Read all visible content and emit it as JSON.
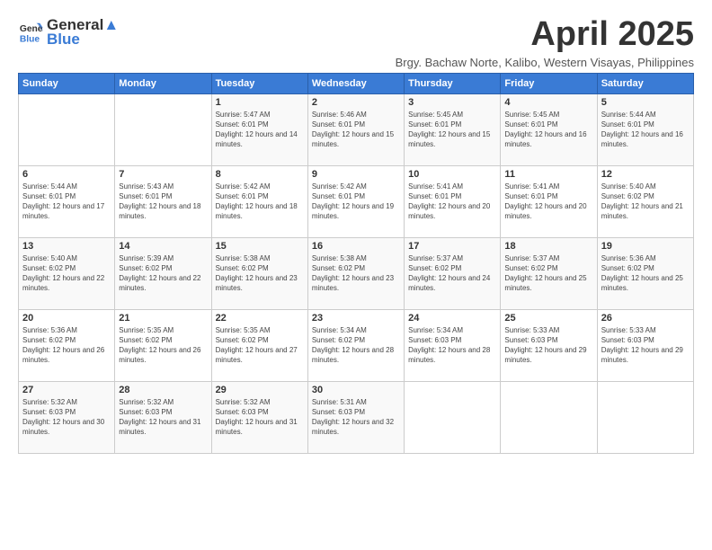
{
  "logo": {
    "text_general": "General",
    "text_blue": "Blue"
  },
  "header": {
    "month_year": "April 2025",
    "subtitle": "Brgy. Bachaw Norte, Kalibo, Western Visayas, Philippines"
  },
  "days_of_week": [
    "Sunday",
    "Monday",
    "Tuesday",
    "Wednesday",
    "Thursday",
    "Friday",
    "Saturday"
  ],
  "weeks": [
    [
      {
        "day": "",
        "sunrise": "",
        "sunset": "",
        "daylight": ""
      },
      {
        "day": "",
        "sunrise": "",
        "sunset": "",
        "daylight": ""
      },
      {
        "day": "1",
        "sunrise": "Sunrise: 5:47 AM",
        "sunset": "Sunset: 6:01 PM",
        "daylight": "Daylight: 12 hours and 14 minutes."
      },
      {
        "day": "2",
        "sunrise": "Sunrise: 5:46 AM",
        "sunset": "Sunset: 6:01 PM",
        "daylight": "Daylight: 12 hours and 15 minutes."
      },
      {
        "day": "3",
        "sunrise": "Sunrise: 5:45 AM",
        "sunset": "Sunset: 6:01 PM",
        "daylight": "Daylight: 12 hours and 15 minutes."
      },
      {
        "day": "4",
        "sunrise": "Sunrise: 5:45 AM",
        "sunset": "Sunset: 6:01 PM",
        "daylight": "Daylight: 12 hours and 16 minutes."
      },
      {
        "day": "5",
        "sunrise": "Sunrise: 5:44 AM",
        "sunset": "Sunset: 6:01 PM",
        "daylight": "Daylight: 12 hours and 16 minutes."
      }
    ],
    [
      {
        "day": "6",
        "sunrise": "Sunrise: 5:44 AM",
        "sunset": "Sunset: 6:01 PM",
        "daylight": "Daylight: 12 hours and 17 minutes."
      },
      {
        "day": "7",
        "sunrise": "Sunrise: 5:43 AM",
        "sunset": "Sunset: 6:01 PM",
        "daylight": "Daylight: 12 hours and 18 minutes."
      },
      {
        "day": "8",
        "sunrise": "Sunrise: 5:42 AM",
        "sunset": "Sunset: 6:01 PM",
        "daylight": "Daylight: 12 hours and 18 minutes."
      },
      {
        "day": "9",
        "sunrise": "Sunrise: 5:42 AM",
        "sunset": "Sunset: 6:01 PM",
        "daylight": "Daylight: 12 hours and 19 minutes."
      },
      {
        "day": "10",
        "sunrise": "Sunrise: 5:41 AM",
        "sunset": "Sunset: 6:01 PM",
        "daylight": "Daylight: 12 hours and 20 minutes."
      },
      {
        "day": "11",
        "sunrise": "Sunrise: 5:41 AM",
        "sunset": "Sunset: 6:01 PM",
        "daylight": "Daylight: 12 hours and 20 minutes."
      },
      {
        "day": "12",
        "sunrise": "Sunrise: 5:40 AM",
        "sunset": "Sunset: 6:02 PM",
        "daylight": "Daylight: 12 hours and 21 minutes."
      }
    ],
    [
      {
        "day": "13",
        "sunrise": "Sunrise: 5:40 AM",
        "sunset": "Sunset: 6:02 PM",
        "daylight": "Daylight: 12 hours and 22 minutes."
      },
      {
        "day": "14",
        "sunrise": "Sunrise: 5:39 AM",
        "sunset": "Sunset: 6:02 PM",
        "daylight": "Daylight: 12 hours and 22 minutes."
      },
      {
        "day": "15",
        "sunrise": "Sunrise: 5:38 AM",
        "sunset": "Sunset: 6:02 PM",
        "daylight": "Daylight: 12 hours and 23 minutes."
      },
      {
        "day": "16",
        "sunrise": "Sunrise: 5:38 AM",
        "sunset": "Sunset: 6:02 PM",
        "daylight": "Daylight: 12 hours and 23 minutes."
      },
      {
        "day": "17",
        "sunrise": "Sunrise: 5:37 AM",
        "sunset": "Sunset: 6:02 PM",
        "daylight": "Daylight: 12 hours and 24 minutes."
      },
      {
        "day": "18",
        "sunrise": "Sunrise: 5:37 AM",
        "sunset": "Sunset: 6:02 PM",
        "daylight": "Daylight: 12 hours and 25 minutes."
      },
      {
        "day": "19",
        "sunrise": "Sunrise: 5:36 AM",
        "sunset": "Sunset: 6:02 PM",
        "daylight": "Daylight: 12 hours and 25 minutes."
      }
    ],
    [
      {
        "day": "20",
        "sunrise": "Sunrise: 5:36 AM",
        "sunset": "Sunset: 6:02 PM",
        "daylight": "Daylight: 12 hours and 26 minutes."
      },
      {
        "day": "21",
        "sunrise": "Sunrise: 5:35 AM",
        "sunset": "Sunset: 6:02 PM",
        "daylight": "Daylight: 12 hours and 26 minutes."
      },
      {
        "day": "22",
        "sunrise": "Sunrise: 5:35 AM",
        "sunset": "Sunset: 6:02 PM",
        "daylight": "Daylight: 12 hours and 27 minutes."
      },
      {
        "day": "23",
        "sunrise": "Sunrise: 5:34 AM",
        "sunset": "Sunset: 6:02 PM",
        "daylight": "Daylight: 12 hours and 28 minutes."
      },
      {
        "day": "24",
        "sunrise": "Sunrise: 5:34 AM",
        "sunset": "Sunset: 6:03 PM",
        "daylight": "Daylight: 12 hours and 28 minutes."
      },
      {
        "day": "25",
        "sunrise": "Sunrise: 5:33 AM",
        "sunset": "Sunset: 6:03 PM",
        "daylight": "Daylight: 12 hours and 29 minutes."
      },
      {
        "day": "26",
        "sunrise": "Sunrise: 5:33 AM",
        "sunset": "Sunset: 6:03 PM",
        "daylight": "Daylight: 12 hours and 29 minutes."
      }
    ],
    [
      {
        "day": "27",
        "sunrise": "Sunrise: 5:32 AM",
        "sunset": "Sunset: 6:03 PM",
        "daylight": "Daylight: 12 hours and 30 minutes."
      },
      {
        "day": "28",
        "sunrise": "Sunrise: 5:32 AM",
        "sunset": "Sunset: 6:03 PM",
        "daylight": "Daylight: 12 hours and 31 minutes."
      },
      {
        "day": "29",
        "sunrise": "Sunrise: 5:32 AM",
        "sunset": "Sunset: 6:03 PM",
        "daylight": "Daylight: 12 hours and 31 minutes."
      },
      {
        "day": "30",
        "sunrise": "Sunrise: 5:31 AM",
        "sunset": "Sunset: 6:03 PM",
        "daylight": "Daylight: 12 hours and 32 minutes."
      },
      {
        "day": "",
        "sunrise": "",
        "sunset": "",
        "daylight": ""
      },
      {
        "day": "",
        "sunrise": "",
        "sunset": "",
        "daylight": ""
      },
      {
        "day": "",
        "sunrise": "",
        "sunset": "",
        "daylight": ""
      }
    ]
  ]
}
